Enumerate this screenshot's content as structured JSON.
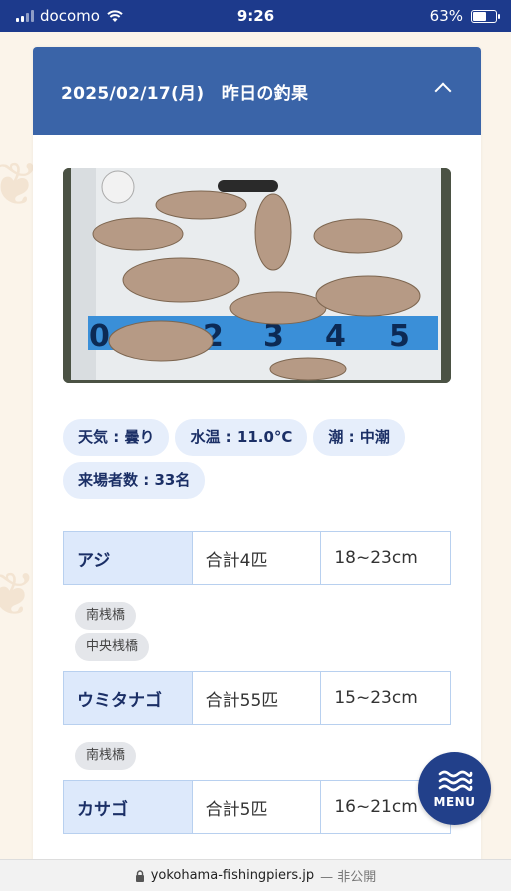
{
  "status_bar": {
    "carrier": "docomo",
    "time": "9:26",
    "battery_pct": "63%",
    "battery_level": 0.63
  },
  "report": {
    "title": "2025/02/17(月)　昨日の釣果",
    "toggle_icon": "chevron-up-icon"
  },
  "conditions": {
    "weather": "天気 : 曇り",
    "water_temp": "水温 : 11.0°C",
    "tide": "潮 : 中潮",
    "visitors": "来場者数 : 33名"
  },
  "catches": [
    {
      "name": "アジ",
      "total": "合計4匹",
      "size": "18~23cm",
      "locations": [
        "南桟橋",
        "中央桟橋"
      ]
    },
    {
      "name": "ウミタナゴ",
      "total": "合計55匹",
      "size": "15~23cm",
      "locations": [
        "南桟橋"
      ]
    },
    {
      "name": "カサゴ",
      "total": "合計5匹",
      "size": "16~21cm",
      "locations": []
    }
  ],
  "menu": {
    "label": "MENU",
    "icon": "waves-icon"
  },
  "url_bar": {
    "domain": "yokohama-fishingpiers.jp",
    "visibility": "— 非公開",
    "icon": "lock-icon"
  },
  "colors": {
    "header": "#3a64a8",
    "status_bar": "#1d3a8c",
    "tag_bg": "#e6eefb",
    "menu": "#22408a"
  }
}
